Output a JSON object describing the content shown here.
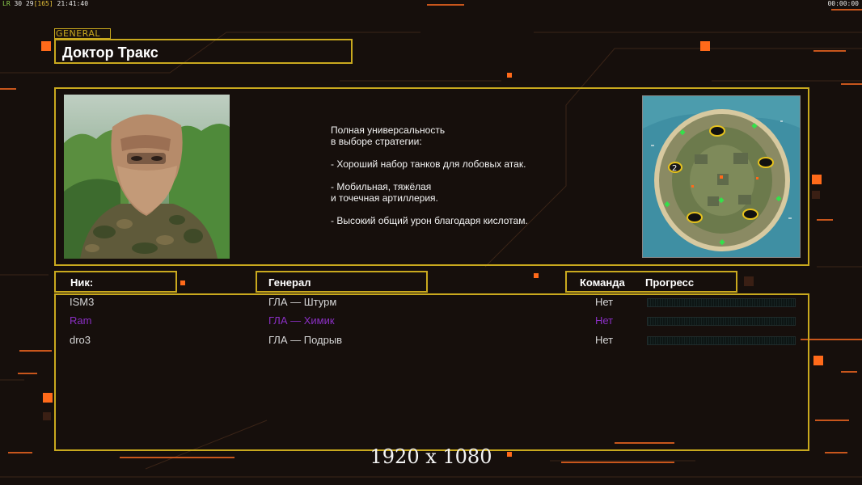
{
  "status_bar": {
    "fps_label": "LR",
    "fps_value": "30",
    "frame_value": "29",
    "frame_total": "[165]",
    "clock": "21:41:40",
    "timer": "00:00:00"
  },
  "general": {
    "badge": "GENERAL",
    "name": "Доктор Тракс",
    "description": [
      "Полная универсальность",
      "в выборе стратегии:",
      "",
      "- Хороший набор танков для лобовых атак.",
      "",
      "- Мобильная, тяжёлая",
      "и точечная артиллерия.",
      "",
      "- Высокий общий урон благодаря кислотам."
    ]
  },
  "map": {
    "icon": "island-map-preview",
    "start_marker_label": "2"
  },
  "table": {
    "headers": {
      "nick": "Ник:",
      "general": "Генерал",
      "team": "Команда",
      "progress": "Прогресс"
    },
    "rows": [
      {
        "nick": "ISM3",
        "general": "ГЛА — Штурм",
        "team": "Нет",
        "progress": 0,
        "color": "#d6d6d6"
      },
      {
        "nick": "Ram",
        "general": "ГЛА — Химик",
        "team": "Нет",
        "progress": 0,
        "color": "#8a2fc4"
      },
      {
        "nick": "dro3",
        "general": "ГЛА — Подрыв",
        "team": "Нет",
        "progress": 0,
        "color": "#d6d6d6"
      }
    ]
  },
  "overlay": {
    "resolution": "1920 x 1080"
  },
  "colors": {
    "frame": "#c9a91e",
    "accent": "#ff6a1a",
    "background": "#160f0c"
  }
}
